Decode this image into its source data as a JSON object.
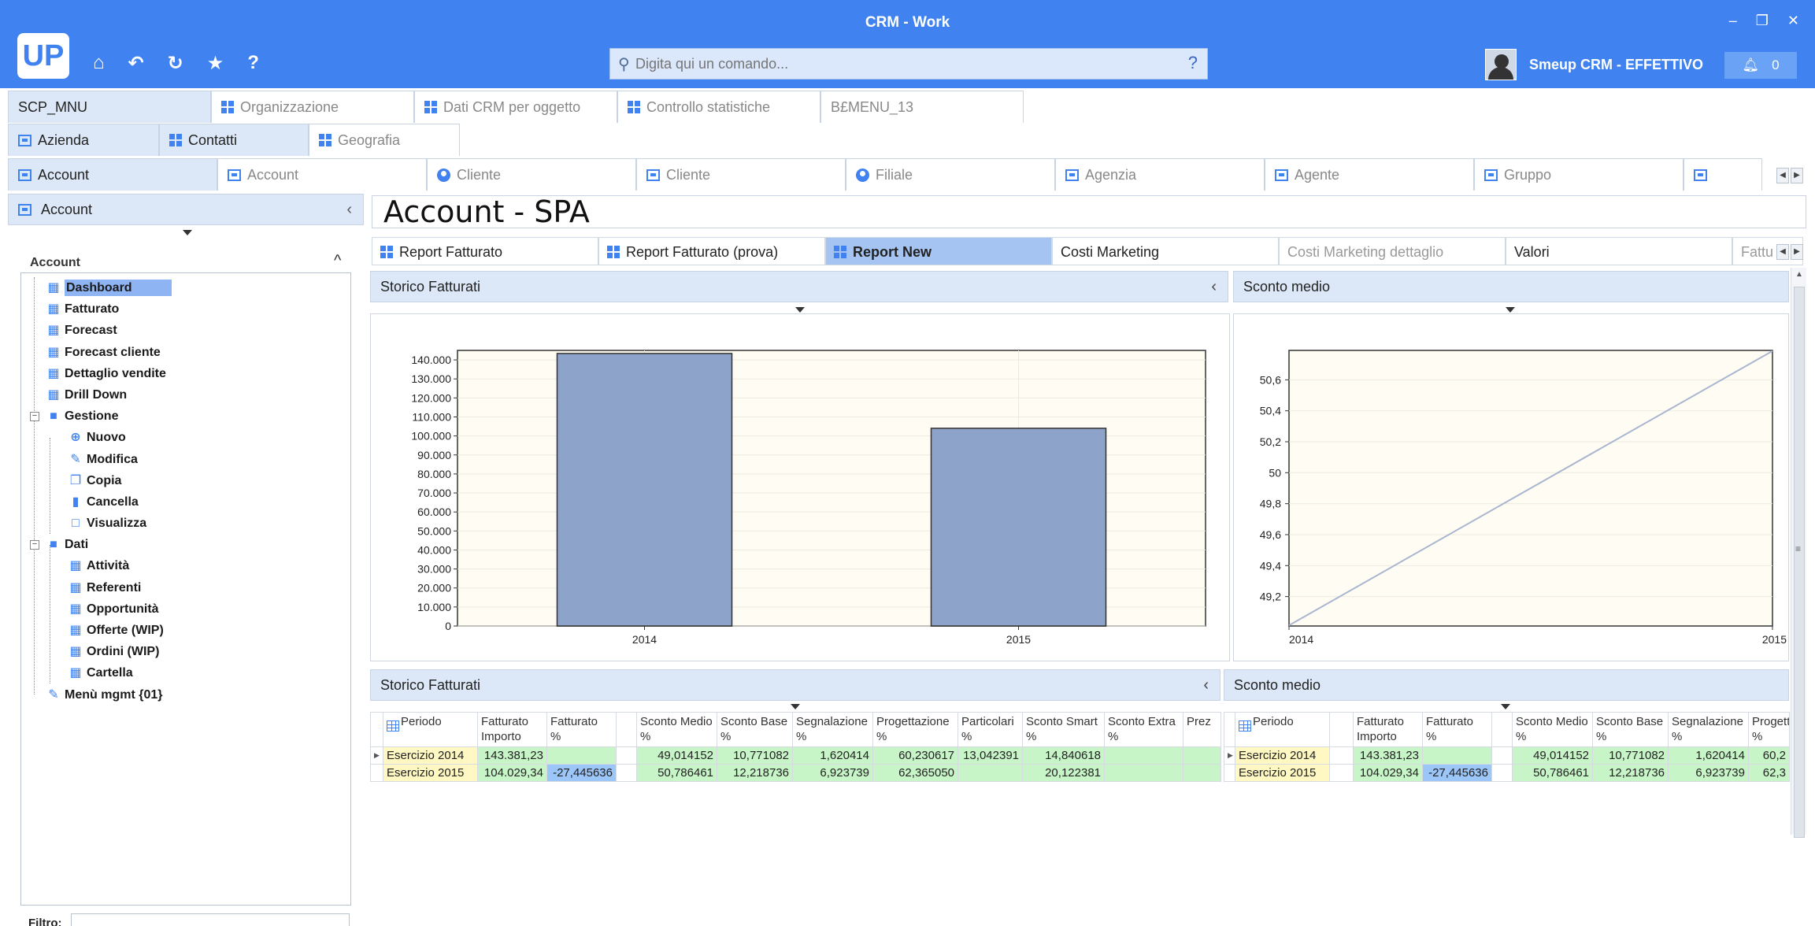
{
  "window": {
    "title": "CRM - Work",
    "logo": "UP",
    "controls": [
      "–",
      "❐",
      "✕"
    ],
    "quick_icons": [
      "home-icon",
      "undo-icon",
      "refresh-icon",
      "star-icon",
      "help-icon"
    ],
    "command_placeholder": "Digita qui un comando...",
    "command_help": "?",
    "user": "Smeup CRM - EFFETTIVO",
    "notifications": "0"
  },
  "nav_rows": {
    "row1": [
      {
        "label": "SCP_MNU",
        "icon": "none",
        "active": true
      },
      {
        "label": "Organizzazione",
        "icon": "grid-icon"
      },
      {
        "label": "Dati CRM per oggetto",
        "icon": "grid-icon"
      },
      {
        "label": "Controllo statistiche",
        "icon": "grid-icon"
      },
      {
        "label": "B£MENU_13",
        "icon": "none"
      }
    ],
    "row2": [
      {
        "label": "Azienda",
        "icon": "card-icon",
        "active": true
      },
      {
        "label": "Contatti",
        "icon": "grid-icon",
        "active": true
      },
      {
        "label": "Geografia",
        "icon": "grid-icon"
      }
    ],
    "row3": [
      {
        "label": "Account",
        "icon": "card-icon",
        "active": true
      },
      {
        "label": "Account",
        "icon": "card-icon"
      },
      {
        "label": "Cliente",
        "icon": "person-icon"
      },
      {
        "label": "Cliente",
        "icon": "card-icon"
      },
      {
        "label": "Filiale",
        "icon": "person-icon"
      },
      {
        "label": "Agenzia",
        "icon": "card-icon"
      },
      {
        "label": "Agente",
        "icon": "card-icon"
      },
      {
        "label": "Gruppo",
        "icon": "card-icon"
      },
      {
        "label": "",
        "icon": "card-icon"
      }
    ]
  },
  "left_panel": {
    "header": "Account",
    "tree_title": "Account",
    "filter_label": "Filtro:",
    "tree": [
      {
        "label": "Dashboard",
        "level": 1,
        "icon": "grid-icon",
        "selected": true
      },
      {
        "label": "Fatturato",
        "level": 1,
        "icon": "grid-icon"
      },
      {
        "label": "Forecast",
        "level": 1,
        "icon": "grid-icon"
      },
      {
        "label": "Forecast cliente",
        "level": 1,
        "icon": "grid-icon"
      },
      {
        "label": "Dettaglio vendite",
        "level": 1,
        "icon": "grid-icon"
      },
      {
        "label": "Drill Down",
        "level": 1,
        "icon": "grid-icon"
      },
      {
        "label": "Gestione",
        "level": 1,
        "icon": "folder-icon",
        "expander": true
      },
      {
        "label": "Nuovo",
        "level": 2,
        "icon": "plus-circle-icon"
      },
      {
        "label": "Modifica",
        "level": 2,
        "icon": "pencil-icon"
      },
      {
        "label": "Copia",
        "level": 2,
        "icon": "copy-icon"
      },
      {
        "label": "Cancella",
        "level": 2,
        "icon": "trash-icon"
      },
      {
        "label": "Visualizza",
        "level": 2,
        "icon": "square-icon"
      },
      {
        "label": "Dati",
        "level": 1,
        "icon": "folder-icon",
        "expander": true
      },
      {
        "label": "Attività",
        "level": 2,
        "icon": "grid-icon"
      },
      {
        "label": "Referenti",
        "level": 2,
        "icon": "grid-icon"
      },
      {
        "label": "Opportunità",
        "level": 2,
        "icon": "grid-icon"
      },
      {
        "label": "Offerte (WIP)",
        "level": 2,
        "icon": "grid-icon"
      },
      {
        "label": "Ordini (WIP)",
        "level": 2,
        "icon": "grid-icon"
      },
      {
        "label": "Cartella",
        "level": 2,
        "icon": "grid-icon"
      },
      {
        "label": "Menù mgmt {01}",
        "level": 1,
        "icon": "pencil-icon"
      }
    ]
  },
  "main": {
    "title": "Account - SPA",
    "report_tabs": [
      {
        "label": "Report Fatturato",
        "icon": "grid-icon"
      },
      {
        "label": "Report Fatturato (prova)",
        "icon": "grid-icon"
      },
      {
        "label": "Report New",
        "icon": "grid-icon",
        "active": true
      },
      {
        "label": "Costi Marketing",
        "icon": "none"
      },
      {
        "label": "Costi Marketing dettaglio",
        "icon": "none",
        "dim": true
      },
      {
        "label": "Valori",
        "icon": "none"
      },
      {
        "label": "Fattu",
        "icon": "none",
        "dim": true
      }
    ],
    "chart_sections": [
      "Storico Fatturati",
      "Sconto medio"
    ],
    "table_sections": [
      "Storico Fatturati",
      "Sconto medio"
    ]
  },
  "chart_data": [
    {
      "type": "bar",
      "title": "Storico Fatturati",
      "categories": [
        "2014",
        "2015"
      ],
      "values": [
        143381.23,
        104029.34
      ],
      "ylim": [
        0,
        145000
      ],
      "yticks": [
        "0",
        "10.000",
        "20.000",
        "30.000",
        "40.000",
        "50.000",
        "60.000",
        "70.000",
        "80.000",
        "90.000",
        "100.000",
        "110.000",
        "120.000",
        "130.000",
        "140.000"
      ],
      "ytick_values": [
        0,
        10000,
        20000,
        30000,
        40000,
        50000,
        60000,
        70000,
        80000,
        90000,
        100000,
        110000,
        120000,
        130000,
        140000
      ],
      "bar_color": "#8da3ca",
      "background": "#fffdf3",
      "grid": true
    },
    {
      "type": "line",
      "title": "Sconto medio",
      "x": [
        "2014",
        "2015"
      ],
      "series": [
        {
          "values": [
            49.014152,
            50.786461
          ]
        }
      ],
      "ylim": [
        49.01,
        50.79
      ],
      "yticks": [
        "49,2",
        "49,4",
        "49,6",
        "49,8",
        "50",
        "50,2",
        "50,4",
        "50,6"
      ],
      "ytick_values": [
        49.2,
        49.4,
        49.6,
        49.8,
        50.0,
        50.2,
        50.4,
        50.6
      ],
      "line_color": "#a9b6d0",
      "background": "#fffdf3",
      "grid": true
    }
  ],
  "tables": {
    "left": {
      "headers": [
        "Periodo",
        "Fatturato\nImporto",
        "Fatturato\n%",
        "",
        "Sconto Medio\n%",
        "Sconto Base\n%",
        "Segnalazione\n%",
        "Progettazione\n%",
        "Particolari\n%",
        "Sconto Smart\n%",
        "Sconto Extra\n%",
        "Prez"
      ],
      "rows": [
        [
          "Esercizio 2014",
          "143.381,23",
          "",
          "",
          "49,014152",
          "10,771082",
          "1,620414",
          "60,230617",
          "13,042391",
          "14,840618",
          "",
          ""
        ],
        [
          "Esercizio 2015",
          "104.029,34",
          "-27,445636",
          "",
          "50,786461",
          "12,218736",
          "6,923739",
          "62,365050",
          "",
          "20,122381",
          "",
          ""
        ]
      ]
    },
    "right": {
      "headers": [
        "Periodo",
        "",
        "Fatturato\nImporto",
        "Fatturato\n%",
        "",
        "Sconto Medio\n%",
        "Sconto Base\n%",
        "Segnalazione\n%",
        "Progetta\n%"
      ],
      "rows": [
        [
          "Esercizio 2014",
          "",
          "143.381,23",
          "",
          "",
          "49,014152",
          "10,771082",
          "1,620414",
          "60,2"
        ],
        [
          "Esercizio 2015",
          "",
          "104.029,34",
          "-27,445636",
          "",
          "50,786461",
          "12,218736",
          "6,923739",
          "62,3"
        ]
      ]
    }
  }
}
